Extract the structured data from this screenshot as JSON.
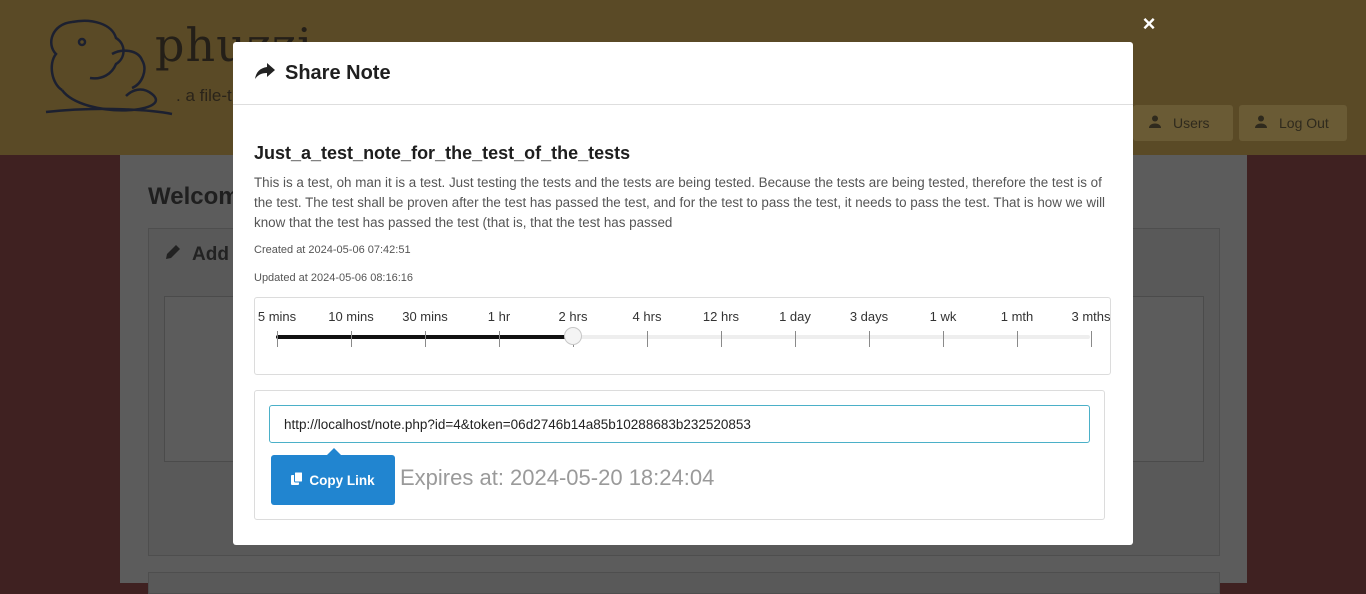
{
  "background": {
    "logo_text": "phuzzi",
    "logo_sub": ". a file-t",
    "nav_users": "Users",
    "nav_logout": "Log Out",
    "welcome": "Welcom",
    "panel_title": "Add a"
  },
  "modal": {
    "close_label": "×",
    "title": "Share Note",
    "note_title": "Just_a_test_note_for_the_test_of_the_tests",
    "note_body": "This is a test, oh man it is a test. Just testing the tests and the tests are being tested. Because the tests are being tested, therefore the test is of the test. The test shall be proven after the test has passed the test, and for the test to pass the test, it needs to pass the test. That is how we will know that the test has passed the test (that is, that the test has passed",
    "created": "Created at 2024-05-06 07:42:51",
    "updated": "Updated at 2024-05-06 08:16:16"
  },
  "slider": {
    "ticks": [
      "5 mins",
      "10 mins",
      "30 mins",
      "1 hr",
      "2 hrs",
      "4 hrs",
      "12 hrs",
      "1 day",
      "3 days",
      "1 wk",
      "1 mth",
      "3 mths"
    ],
    "selected_index": 4,
    "selected_label": "2 hrs"
  },
  "share": {
    "link": "http://localhost/note.php?id=4&token=06d2746b14a85b10288683b232520853",
    "copy_label": "Copy Link",
    "expires": "Expires at: 2024-05-20 18:24:04"
  },
  "colors": {
    "primary": "#2185d0",
    "input_focus": "#4bb0c8",
    "backdrop_header": "#5a4a26",
    "backdrop_body": "#3f2121"
  }
}
